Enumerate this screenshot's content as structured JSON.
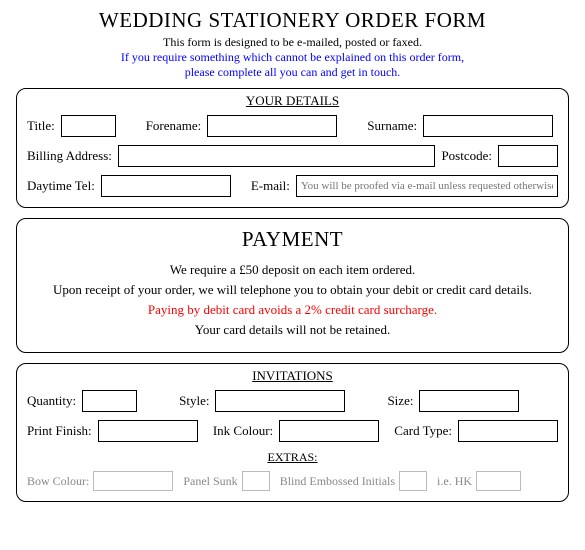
{
  "header": {
    "title": "WEDDING STATIONERY ORDER FORM",
    "subtitle": "This form is designed to be e-mailed, posted or faxed.",
    "note_line1": "If you require something which cannot be explained on this order form,",
    "note_line2": "please complete all you can and get in touch."
  },
  "details": {
    "section_title": "YOUR DETAILS",
    "title_label": "Title:",
    "forename_label": "Forename:",
    "surname_label": "Surname:",
    "billing_label": "Billing Address:",
    "postcode_label": "Postcode:",
    "daytime_tel_label": "Daytime Tel:",
    "email_label": "E-mail:",
    "email_placeholder": "You will be proofed via e-mail unless requested otherwise"
  },
  "payment": {
    "section_title": "PAYMENT",
    "line1": "We require a £50 deposit on each item ordered.",
    "line2": "Upon receipt of your order, we will telephone you to obtain your debit or credit card details.",
    "line3": "Paying by debit card avoids a 2% credit card surcharge.",
    "line4": "Your card details will not be retained."
  },
  "invitations": {
    "section_title": "INVITATIONS",
    "quantity_label": "Quantity:",
    "style_label": "Style:",
    "size_label": "Size:",
    "print_finish_label": "Print Finish:",
    "ink_colour_label": "Ink Colour:",
    "card_type_label": "Card Type:",
    "extras_title": "EXTRAS:",
    "bow_colour_label": "Bow Colour:",
    "panel_sunk_label": "Panel Sunk",
    "blind_embossed_label": "Blind Embossed Initials",
    "ie_hk": "i.e. HK"
  }
}
